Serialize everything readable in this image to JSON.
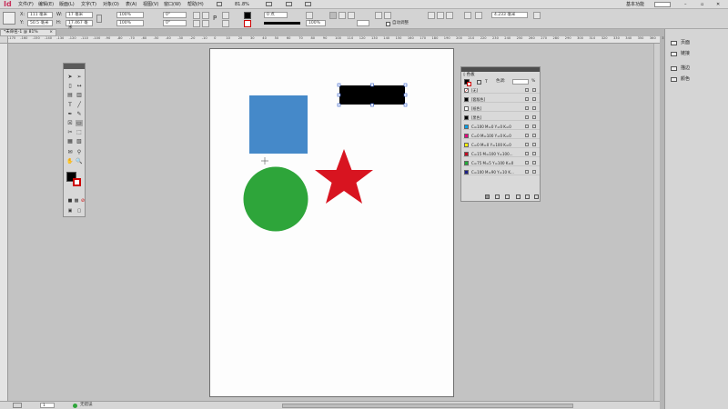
{
  "app": {
    "logo": "Id"
  },
  "menu": {
    "items": [
      "文件(F)",
      "编辑(E)",
      "版面(L)",
      "文字(T)",
      "对象(O)",
      "表(A)",
      "视图(V)",
      "窗口(W)",
      "帮助(H)"
    ],
    "zoom": "81.8%",
    "workspace": "基本功能"
  },
  "control": {
    "x_label": "X:",
    "x_value": "111 毫米",
    "y_label": "Y:",
    "y_value": "50.5 毫米",
    "w_label": "W:",
    "w_value": "17 毫米",
    "h_label": "H:",
    "h_value": "17.467 毫米",
    "scale_x": "100%",
    "scale_y": "100%",
    "rotate": "0°",
    "shear": "0°",
    "stroke_weight": "0 点",
    "opacity": "100%",
    "offset": "4.233 毫米",
    "auto_fit": "自动调整"
  },
  "document": {
    "tab_title": "*未命名-1 @ 81%"
  },
  "ruler": {
    "h_ticks": [
      "-170",
      "-160",
      "-150",
      "-140",
      "-130",
      "-120",
      "-110",
      "-100",
      "-90",
      "-80",
      "-70",
      "-60",
      "-50",
      "-40",
      "-30",
      "-20",
      "-10",
      "0",
      "10",
      "20",
      "30",
      "40",
      "50",
      "60",
      "70",
      "80",
      "90",
      "100",
      "110",
      "120",
      "130",
      "140",
      "150",
      "160",
      "170",
      "180",
      "190",
      "200",
      "210",
      "220",
      "230",
      "240",
      "250",
      "260",
      "270",
      "280",
      "290",
      "300",
      "310",
      "320",
      "330",
      "340",
      "350",
      "360",
      "370",
      "380"
    ]
  },
  "status": {
    "page": "1",
    "state": "无错误"
  },
  "dock": {
    "items": [
      {
        "label": "页面",
        "icon": "pages-icon"
      },
      {
        "label": "链接",
        "icon": "links-icon"
      },
      {
        "label": "描边",
        "icon": "stroke-icon"
      },
      {
        "label": "颜色",
        "icon": "color-icon"
      }
    ]
  },
  "swatches": {
    "tab": "◊ 色板",
    "tint_label": "色调:",
    "tint_value": "",
    "percent": "%",
    "rows": [
      {
        "name": "[无]",
        "color": "#ffffff"
      },
      {
        "name": "[套版色]",
        "color": "#000000"
      },
      {
        "name": "[纸色]",
        "color": "#ffffff"
      },
      {
        "name": "[黑色]",
        "color": "#000000"
      },
      {
        "name": "C=100 M=0 Y=0 K=0",
        "color": "#00a0e9"
      },
      {
        "name": "C=0 M=100 Y=0 K=0",
        "color": "#e4007f"
      },
      {
        "name": "C=0 M=0 Y=100 K=0",
        "color": "#fff100"
      },
      {
        "name": "C=15 M=100 Y=100...",
        "color": "#c30d23"
      },
      {
        "name": "C=75 M=5 Y=100 K=0",
        "color": "#22ac38"
      },
      {
        "name": "C=100 M=90 Y=10 K...",
        "color": "#1d2088"
      }
    ]
  },
  "canvas_shapes": {
    "blue_square": "#4589c9",
    "black_rect": "#000000",
    "green_circle": "#2ea53a",
    "red_star": "#d81420"
  }
}
